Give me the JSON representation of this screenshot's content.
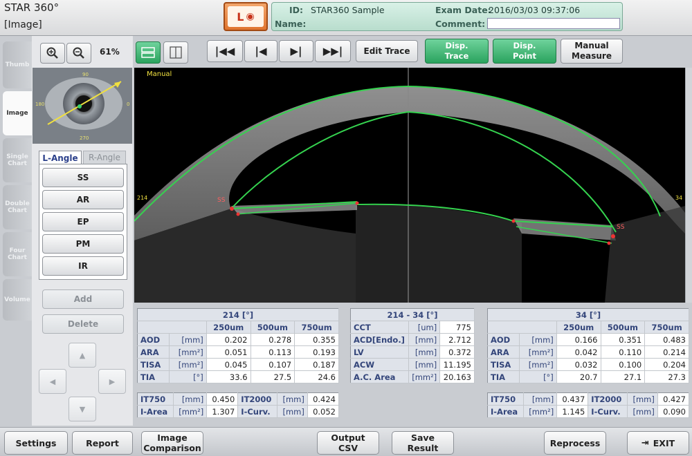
{
  "header": {
    "title": "STAR 360°",
    "subtitle": "[Image]",
    "logo_text": "L",
    "id_label": "ID:",
    "id_value": "STAR360 Sample",
    "exam_label": "Exam Date:",
    "exam_value": "2016/03/03 09:37:06",
    "name_label": "Name:",
    "name_value": "",
    "comment_label": "Comment:",
    "comment_value": ""
  },
  "left_tabs": [
    "Thumb",
    "Image",
    "Single Chart",
    "Double Chart",
    "Four Chart",
    "Volume"
  ],
  "toolbar": {
    "zoom": "61%",
    "edit_trace": "Edit Trace",
    "disp_trace_1": "Disp.",
    "disp_trace_2": "Trace",
    "disp_point_1": "Disp.",
    "disp_point_2": "Point",
    "manual_1": "Manual",
    "manual_2": "Measure"
  },
  "image": {
    "mode_label": "Manual",
    "left_marker": "214",
    "right_marker": "34",
    "ss_left": "SS",
    "ss_right": "SS",
    "thumb_labels": {
      "top": "90",
      "bottom": "270",
      "left": "180",
      "right": "0"
    }
  },
  "angle_tabs": {
    "left": "L-Angle",
    "right": "R-Angle"
  },
  "angle_buttons": [
    "SS",
    "AR",
    "EP",
    "PM",
    "IR"
  ],
  "actions": {
    "add": "Add",
    "delete": "Delete"
  },
  "table_left": {
    "title": "214 [°]",
    "columns": [
      "250um",
      "500um",
      "750um"
    ],
    "rows": [
      {
        "label": "AOD",
        "unit": "[mm]",
        "values": [
          "0.202",
          "0.278",
          "0.355"
        ]
      },
      {
        "label": "ARA",
        "unit": "[mm²]",
        "values": [
          "0.051",
          "0.113",
          "0.193"
        ]
      },
      {
        "label": "TISA",
        "unit": "[mm²]",
        "values": [
          "0.045",
          "0.107",
          "0.187"
        ]
      },
      {
        "label": "TIA",
        "unit": "[°]",
        "values": [
          "33.6",
          "27.5",
          "24.6"
        ]
      }
    ],
    "extra": [
      {
        "l1": "IT750",
        "u1": "[mm]",
        "v1": "0.450",
        "l2": "IT2000",
        "u2": "[mm]",
        "v2": "0.424"
      },
      {
        "l1": "I-Area",
        "u1": "[mm²]",
        "v1": "1.307",
        "l2": "I-Curv.",
        "u2": "[mm]",
        "v2": "0.052"
      }
    ]
  },
  "table_center": {
    "title": "214 - 34 [°]",
    "rows": [
      {
        "label": "CCT",
        "unit": "[um]",
        "value": "775"
      },
      {
        "label": "ACD[Endo.]",
        "unit": "[mm]",
        "value": "2.712"
      },
      {
        "label": "LV",
        "unit": "[mm]",
        "value": "0.372"
      },
      {
        "label": "ACW",
        "unit": "[mm]",
        "value": "11.195"
      },
      {
        "label": "A.C. Area",
        "unit": "[mm²]",
        "value": "20.163"
      }
    ]
  },
  "table_right": {
    "title": "34 [°]",
    "columns": [
      "250um",
      "500um",
      "750um"
    ],
    "rows": [
      {
        "label": "AOD",
        "unit": "[mm]",
        "values": [
          "0.166",
          "0.351",
          "0.483"
        ]
      },
      {
        "label": "ARA",
        "unit": "[mm²]",
        "values": [
          "0.042",
          "0.110",
          "0.214"
        ]
      },
      {
        "label": "TISA",
        "unit": "[mm²]",
        "values": [
          "0.032",
          "0.100",
          "0.204"
        ]
      },
      {
        "label": "TIA",
        "unit": "[°]",
        "values": [
          "20.7",
          "27.1",
          "27.3"
        ]
      }
    ],
    "extra": [
      {
        "l1": "IT750",
        "u1": "[mm]",
        "v1": "0.437",
        "l2": "IT2000",
        "u2": "[mm]",
        "v2": "0.427"
      },
      {
        "l1": "I-Area",
        "u1": "[mm²]",
        "v1": "1.145",
        "l2": "I-Curv.",
        "u2": "[mm]",
        "v2": "0.090"
      }
    ]
  },
  "bottom": {
    "settings": "Settings",
    "report": "Report",
    "image_comp_1": "Image",
    "image_comp_2": "Comparison",
    "output_1": "Output",
    "output_2": "CSV",
    "save_1": "Save",
    "save_2": "Result",
    "reprocess": "Reprocess",
    "exit": "EXIT"
  }
}
